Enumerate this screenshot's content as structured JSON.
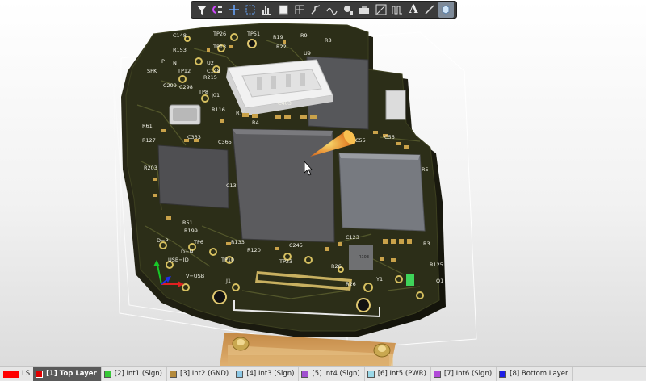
{
  "toolbar": {
    "items": [
      {
        "name": "filter-icon"
      },
      {
        "name": "route-icon"
      },
      {
        "name": "crosshair-icon"
      },
      {
        "name": "select-rect-icon"
      },
      {
        "name": "chart-icon"
      },
      {
        "name": "component-icon"
      },
      {
        "name": "grid-icon"
      },
      {
        "name": "interactive-route-icon"
      },
      {
        "name": "diff-pair-icon"
      },
      {
        "name": "pad-via-icon"
      },
      {
        "name": "fill-icon"
      },
      {
        "name": "region-icon"
      },
      {
        "name": "length-tune-icon"
      },
      {
        "name": "text-icon"
      },
      {
        "name": "line-icon"
      },
      {
        "name": "3d-body-icon"
      }
    ],
    "text_label": "A"
  },
  "board": {
    "designators": [
      {
        "id": "C148a",
        "t": "C148"
      },
      {
        "id": "TP26",
        "t": "TP26"
      },
      {
        "id": "TP51",
        "t": "TP51"
      },
      {
        "id": "R19",
        "t": "R19"
      },
      {
        "id": "R9",
        "t": "R9"
      },
      {
        "id": "R8",
        "t": "R8"
      },
      {
        "id": "R153",
        "t": "R153"
      },
      {
        "id": "TP13",
        "t": "TP13"
      },
      {
        "id": "R22",
        "t": "R22"
      },
      {
        "id": "U9",
        "t": "U9"
      },
      {
        "id": "U2",
        "t": "U2"
      },
      {
        "id": "P",
        "t": "P"
      },
      {
        "id": "N",
        "t": "N"
      },
      {
        "id": "SPK",
        "t": "SPK"
      },
      {
        "id": "TP12",
        "t": "TP12"
      },
      {
        "id": "R215",
        "t": "R215"
      },
      {
        "id": "C148b",
        "t": "C148"
      },
      {
        "id": "C299",
        "t": "C299"
      },
      {
        "id": "C298",
        "t": "C298"
      },
      {
        "id": "TP8",
        "t": "TP8"
      },
      {
        "id": "J01",
        "t": "J01"
      },
      {
        "id": "R116",
        "t": "R116"
      },
      {
        "id": "R61",
        "t": "R61"
      },
      {
        "id": "C403",
        "t": "C403"
      },
      {
        "id": "R7",
        "t": "R7"
      },
      {
        "id": "R4",
        "t": "R4"
      },
      {
        "id": "R127",
        "t": "R127"
      },
      {
        "id": "C333",
        "t": "C333"
      },
      {
        "id": "C365",
        "t": "C365"
      },
      {
        "id": "C55",
        "t": "C55"
      },
      {
        "id": "C56",
        "t": "C56"
      },
      {
        "id": "R203",
        "t": "R203"
      },
      {
        "id": "C13",
        "t": "C13"
      },
      {
        "id": "R51",
        "t": "R51"
      },
      {
        "id": "R199",
        "t": "R199"
      },
      {
        "id": "R133",
        "t": "R133"
      },
      {
        "id": "R120",
        "t": "R120"
      },
      {
        "id": "C245",
        "t": "C245"
      },
      {
        "id": "C123",
        "t": "C123"
      },
      {
        "id": "R3",
        "t": "R3"
      },
      {
        "id": "R5",
        "t": "R5"
      },
      {
        "id": "TP6",
        "t": "TP6"
      },
      {
        "id": "TP10",
        "t": "TP10"
      },
      {
        "id": "TP23",
        "t": "TP23"
      },
      {
        "id": "DP",
        "t": "D−P"
      },
      {
        "id": "DN",
        "t": "D−N"
      },
      {
        "id": "USBID",
        "t": "USB−ID"
      },
      {
        "id": "VUSB",
        "t": "V−USB"
      },
      {
        "id": "J1",
        "t": "J1"
      },
      {
        "id": "R26",
        "t": "R26"
      },
      {
        "id": "Y1",
        "t": "Y1"
      },
      {
        "id": "R125",
        "t": "R125"
      },
      {
        "id": "Q1",
        "t": "Q1"
      },
      {
        "id": "R103",
        "t": "R103"
      },
      {
        "id": "R26b",
        "t": "R26"
      }
    ]
  },
  "layers": {
    "ls_label": "LS",
    "tabs": [
      {
        "label": "[1] Top Layer",
        "color": "#e00000",
        "active": true
      },
      {
        "label": "[2] Int1 (Sign)",
        "color": "#37c837"
      },
      {
        "label": "[3] Int2 (GND)",
        "color": "#b48a3c"
      },
      {
        "label": "[4] Int3 (Sign)",
        "color": "#8cc8e6"
      },
      {
        "label": "[5] Int4 (Sign)",
        "color": "#a050d0"
      },
      {
        "label": "[6] Int5 (PWR)",
        "color": "#9ad8e8"
      },
      {
        "label": "[7] Int6 (Sign)",
        "color": "#b04ad8"
      },
      {
        "label": "[8] Bottom Layer",
        "color": "#1e1ee6"
      }
    ]
  }
}
